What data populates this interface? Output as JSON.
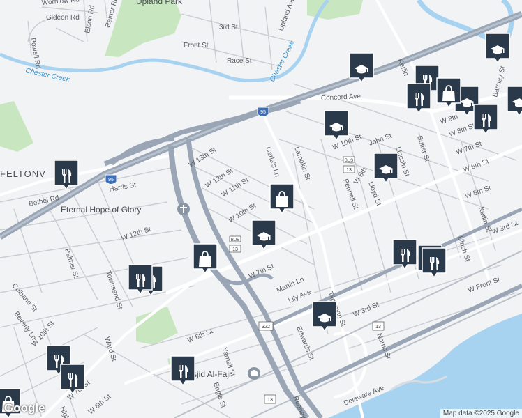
{
  "map": {
    "attribution": "Map data ©2025 Google",
    "logo": "Google",
    "colors": {
      "land": "#f2f3f5",
      "water": "#a7d3f0",
      "park": "#c8e6c0",
      "highway": "#9aa6b5",
      "road": "#ffffff",
      "pin_fill": "#2b3a4a"
    },
    "areas": [
      {
        "name": "Upland Park"
      },
      {
        "name": "FELTONV"
      }
    ],
    "water_labels": [
      {
        "name": "Chester Creek"
      },
      {
        "name": "Chester Creek"
      }
    ],
    "streets": [
      "Wornlow Rd",
      "Gideon Rd",
      "Elson Rd",
      "Rainer Rd",
      "Powell Rd",
      "Upland Ave",
      "3rd St",
      "Front St",
      "Race St",
      "Concord Ave",
      "Kerlin",
      "W 9th",
      "Barclay St",
      "W 8th St",
      "W 10th St",
      "John St",
      "W 7th St",
      "Butler St",
      "Lincoln St",
      "W 6th St",
      "Lamokin St",
      "Carla's Ln",
      "W 13th St",
      "W 12th St",
      "W 11th St",
      "W 10th St",
      "Harris St",
      "W 12th St",
      "Palmer St",
      "Townsend St",
      "Culhane St",
      "Beverly Ln",
      "W 10th St",
      "Ward St",
      "W 6th St",
      "Yarnall St",
      "W 7th St",
      "Martin Ln",
      "Lily Ave",
      "Pennell St",
      "Lloyd St",
      "W 8th",
      "W 5th St",
      "W 3rd St",
      "Ulrich St",
      "Kerlin St",
      "W Front St",
      "W 3rd St",
      "Tilghman St",
      "Edwards St",
      "Norris St",
      "Delaware Ave",
      "Engle St",
      "Reaney St",
      "Highland",
      "W 6th St",
      "W 7th St",
      "Bethel Rd"
    ],
    "places": [
      {
        "name": "Eternal Hope of Glory",
        "icon": "church-icon"
      },
      {
        "name": "sjid Al-Fajr",
        "icon": "mosque-icon"
      }
    ],
    "shields": [
      "95",
      "95",
      "BUS",
      "13",
      "BUS",
      "13",
      "322",
      "13",
      "13"
    ],
    "pins": [
      {
        "type": "school",
        "icon": "graduation-cap-icon"
      },
      {
        "type": "school",
        "icon": "graduation-cap-icon"
      },
      {
        "type": "school",
        "icon": "graduation-cap-icon"
      },
      {
        "type": "school",
        "icon": "graduation-cap-icon"
      },
      {
        "type": "school",
        "icon": "graduation-cap-icon"
      },
      {
        "type": "school",
        "icon": "graduation-cap-icon"
      },
      {
        "type": "school",
        "icon": "graduation-cap-icon"
      },
      {
        "type": "school",
        "icon": "graduation-cap-icon"
      },
      {
        "type": "restaurant",
        "icon": "fork-knife-icon"
      },
      {
        "type": "restaurant",
        "icon": "fork-knife-icon"
      },
      {
        "type": "restaurant",
        "icon": "fork-knife-icon"
      },
      {
        "type": "restaurant",
        "icon": "fork-knife-icon"
      },
      {
        "type": "restaurant",
        "icon": "fork-knife-icon"
      },
      {
        "type": "restaurant",
        "icon": "fork-knife-icon"
      },
      {
        "type": "restaurant",
        "icon": "fork-knife-icon"
      },
      {
        "type": "restaurant",
        "icon": "fork-knife-icon"
      },
      {
        "type": "restaurant",
        "icon": "fork-knife-icon"
      },
      {
        "type": "restaurant",
        "icon": "fork-knife-icon"
      },
      {
        "type": "restaurant",
        "icon": "fork-knife-icon"
      },
      {
        "type": "restaurant",
        "icon": "fork-knife-icon"
      },
      {
        "type": "shopping",
        "icon": "shopping-bag-icon"
      },
      {
        "type": "shopping",
        "icon": "shopping-bag-icon"
      },
      {
        "type": "shopping",
        "icon": "shopping-bag-icon"
      },
      {
        "type": "shopping",
        "icon": "shopping-bag-icon"
      }
    ]
  }
}
